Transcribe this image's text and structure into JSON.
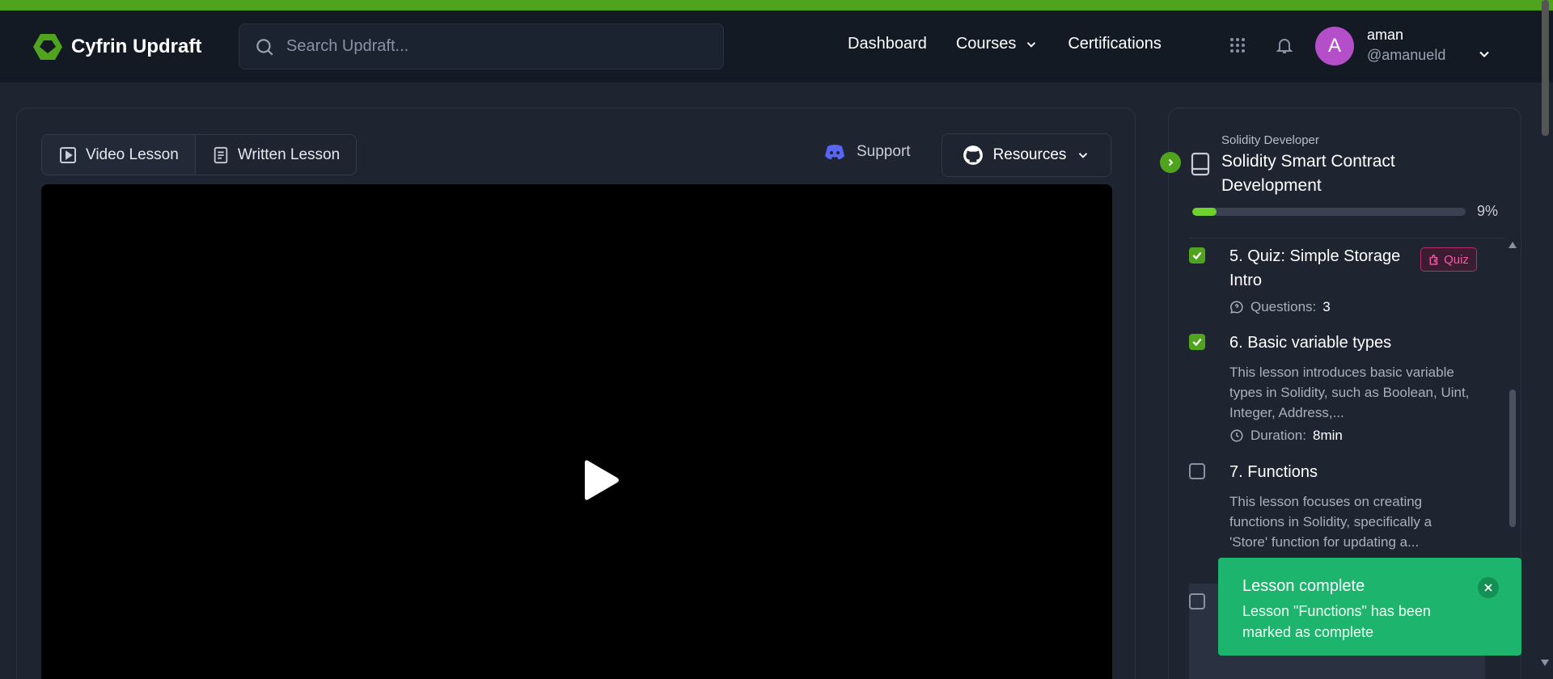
{
  "brand": {
    "name": "Cyfrin Updraft",
    "accent": "#4fa31d"
  },
  "search": {
    "placeholder": "Search Updraft..."
  },
  "nav": {
    "dashboard": "Dashboard",
    "courses": "Courses",
    "certifications": "Certifications"
  },
  "user": {
    "initial": "A",
    "name": "aman",
    "handle": "@amanueld",
    "avatar_color": "#b44fc9"
  },
  "lesson_tabs": {
    "video": "Video Lesson",
    "written": "Written Lesson",
    "active": "video"
  },
  "toolbar": {
    "support": "Support",
    "resources": "Resources"
  },
  "course": {
    "path": "Solidity Developer",
    "title": "Solidity Smart Contract Development",
    "progress_percent": 9,
    "progress_label": "9%"
  },
  "lessons": [
    {
      "title": "5. Quiz: Simple Storage Intro",
      "badge": "Quiz",
      "meta_label": "Questions:",
      "meta_value": "3",
      "completed": true
    },
    {
      "title": "6. Basic variable types",
      "description": "This lesson introduces basic variable types in Solidity, such as Boolean, Uint, Integer, Address,...",
      "meta_label": "Duration:",
      "meta_value": "8min",
      "completed": true
    },
    {
      "title": "7. Functions",
      "description": "This lesson focuses on creating functions in Solidity, specifically a 'Store' function for updating a...",
      "completed": false
    }
  ],
  "toast": {
    "title": "Lesson complete",
    "body": "Lesson \"Functions\" has been marked as complete",
    "color": "#1db56e"
  }
}
